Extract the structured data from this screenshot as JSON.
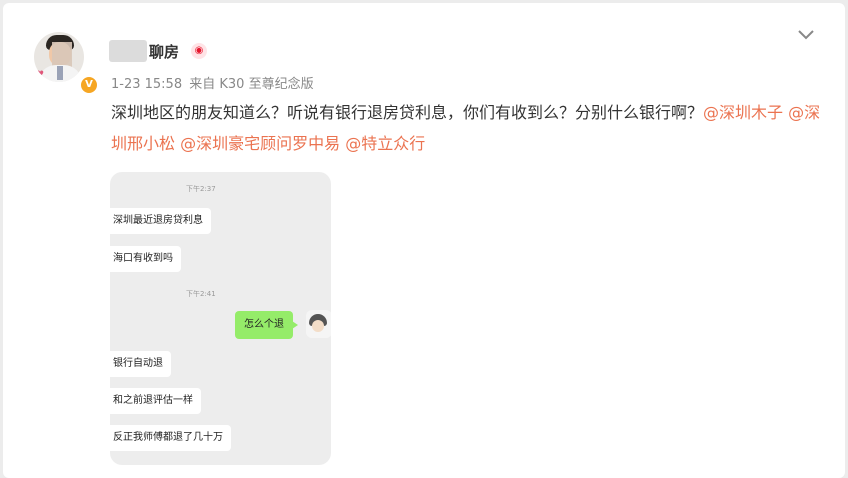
{
  "post": {
    "author_name": "聊房",
    "timestamp": "1-23 15:58",
    "source": "来自 K30 至尊纪念版",
    "text": "深圳地区的朋友知道么？听说有银行退房贷利息，你们有收到么？分别什么银行啊？",
    "mentions": [
      "@深圳木子",
      "@深圳邢小松",
      "@深圳豪宅顾问罗中易",
      "@特立众行"
    ]
  },
  "icons": {
    "verified": "verified-badge-icon",
    "weibo": "weibo-logo-icon",
    "more": "chevron-down-icon"
  },
  "chat": {
    "time1": "下午2:37",
    "time2": "下午2:41",
    "messages": [
      {
        "side": "left",
        "text": "深圳最近退房贷利息"
      },
      {
        "side": "left",
        "text": "海口有收到吗"
      },
      {
        "side": "right",
        "text": "怎么个退"
      },
      {
        "side": "left",
        "text": "银行自动退"
      },
      {
        "side": "left",
        "text": "和之前退评估一样"
      },
      {
        "side": "left",
        "text": "反正我师傅都退了几十万"
      }
    ]
  },
  "colors": {
    "mention": "#eb7350",
    "verified_badge": "#f6a623",
    "chat_bubble_self": "#95ec69",
    "chat_bg": "#ededed"
  }
}
